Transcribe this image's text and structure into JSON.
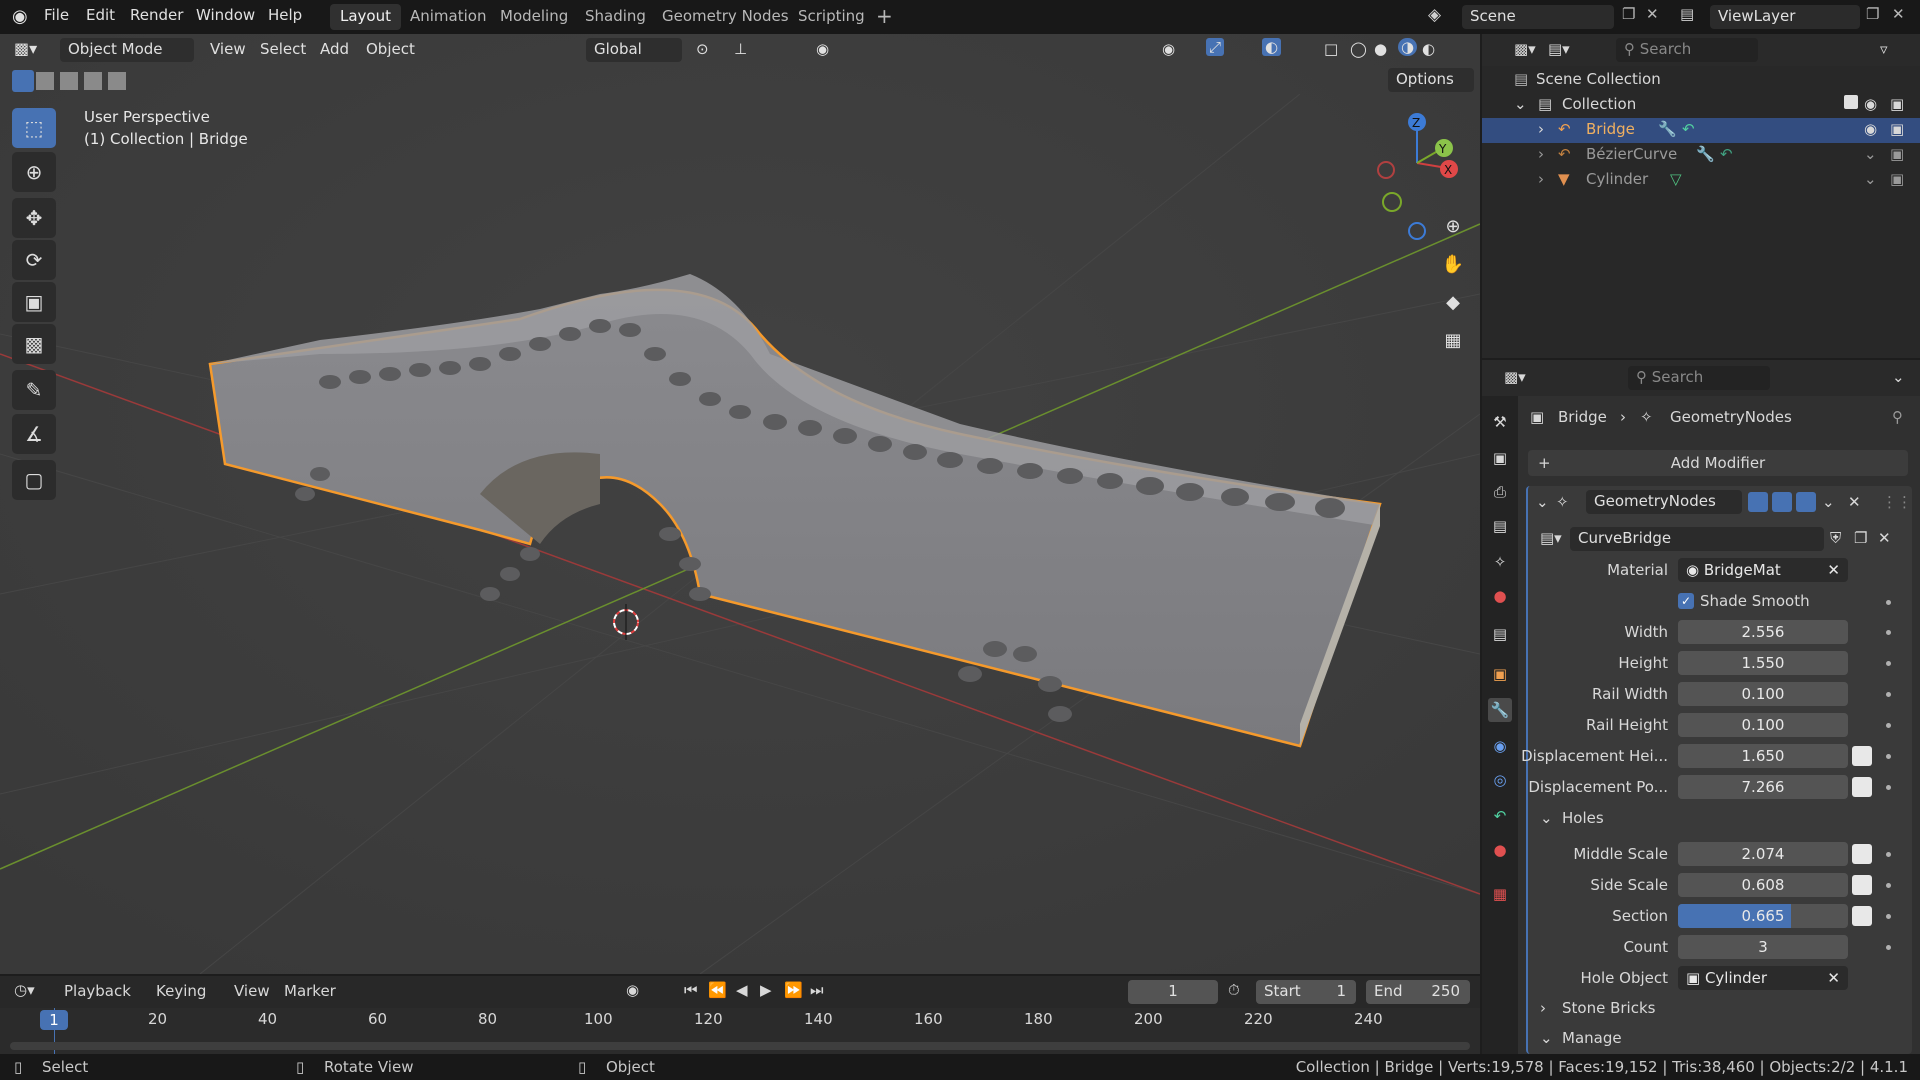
{
  "menu": {
    "items": [
      "File",
      "Edit",
      "Render",
      "Window",
      "Help"
    ]
  },
  "workspaces": [
    {
      "label": "Layout",
      "active": true
    },
    {
      "label": "Animation"
    },
    {
      "label": "Modeling"
    },
    {
      "label": "Shading"
    },
    {
      "label": "Geometry Nodes"
    },
    {
      "label": "Scripting"
    }
  ],
  "scene": {
    "name": "Scene",
    "view_layer": "ViewLayer"
  },
  "viewport_header": {
    "mode": "Object Mode",
    "menus": [
      "View",
      "Select",
      "Add",
      "Object"
    ],
    "orientation": "Global",
    "options": "Options"
  },
  "viewport": {
    "line1": "User Perspective",
    "line2": "(1) Collection | Bridge",
    "axes": {
      "x": "X",
      "y": "Y",
      "z": "Z"
    }
  },
  "outliner": {
    "search_placeholder": "Search",
    "scene_collection": "Scene Collection",
    "collection": "Collection",
    "objects": [
      "Bridge",
      "BézierCurve",
      "Cylinder"
    ]
  },
  "properties": {
    "search_placeholder": "Search",
    "breadcrumb": {
      "object": "Bridge",
      "modifier": "GeometryNodes"
    },
    "add_modifier": "Add Modifier",
    "modifier_name": "GeometryNodes",
    "node_group": "CurveBridge",
    "fields": [
      {
        "label": "Material",
        "value": "BridgeMat"
      },
      {
        "label": "Shade Smooth",
        "checked": true
      },
      {
        "label": "Width",
        "value": "2.556"
      },
      {
        "label": "Height",
        "value": "1.550"
      },
      {
        "label": "Rail Width",
        "value": "0.100"
      },
      {
        "label": "Rail Height",
        "value": "0.100"
      },
      {
        "label": "Displacement Hei...",
        "value": "1.650"
      },
      {
        "label": "Displacement Po...",
        "value": "7.266"
      }
    ],
    "holes": {
      "label": "Holes",
      "fields": [
        {
          "label": "Middle Scale",
          "value": "2.074"
        },
        {
          "label": "Side Scale",
          "value": "0.608"
        },
        {
          "label": "Section",
          "value": "0.665",
          "fraction": 0.665
        },
        {
          "label": "Count",
          "value": "3"
        },
        {
          "label": "Hole Object",
          "value": "Cylinder"
        }
      ]
    },
    "stone_bricks": "Stone Bricks",
    "manage": "Manage"
  },
  "timeline": {
    "menus": [
      "Playback",
      "Keying",
      "View",
      "Marker"
    ],
    "current_frame": "1",
    "start_label": "Start",
    "start": "1",
    "end_label": "End",
    "end": "250",
    "ticks": [
      "20",
      "40",
      "60",
      "80",
      "100",
      "120",
      "140",
      "160",
      "180",
      "200",
      "220",
      "240"
    ],
    "playhead": "1"
  },
  "statusbar": {
    "left": [
      "Select",
      "Rotate View",
      "Object"
    ],
    "stats": "Collection | Bridge | Verts:19,578 | Faces:19,152 | Tris:38,460 | Objects:2/2 | 4.1.1"
  }
}
